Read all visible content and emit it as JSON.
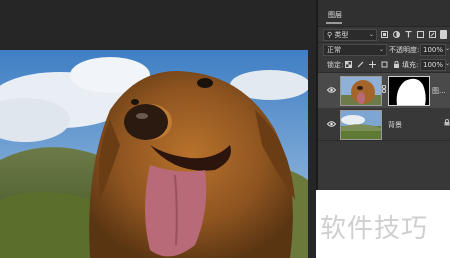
{
  "layers_panel": {
    "tab_label": "图层",
    "filter": {
      "kind_label": "类型"
    },
    "blend": {
      "mode": "正常",
      "opacity_label": "不透明度:",
      "opacity_value": "100%"
    },
    "lock": {
      "label": "锁定:",
      "fill_label": "填充:",
      "fill_value": "100%"
    },
    "layers": [
      {
        "name": "图...",
        "has_mask": true,
        "visible": true,
        "selected": true
      },
      {
        "name": "背景",
        "has_mask": false,
        "visible": true,
        "selected": false
      }
    ]
  },
  "watermark": {
    "text": "软件技巧"
  },
  "colors": {
    "panel_bg": "#383838",
    "canvas_bg": "#262626",
    "selected_layer": "#4a4a4a"
  }
}
